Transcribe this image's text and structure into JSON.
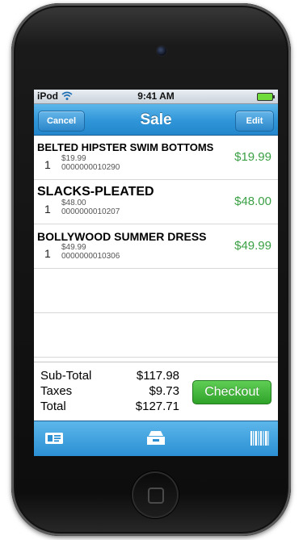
{
  "status": {
    "carrier": "iPod",
    "time": "9:41 AM"
  },
  "nav": {
    "title": "Sale",
    "cancel_label": "Cancel",
    "edit_label": "Edit"
  },
  "items": [
    {
      "name": "BELTED HIPSTER SWIM BOTTOMS",
      "qty": "1",
      "unit_price": "$19.99",
      "sku": "0000000010290",
      "price": "$19.99"
    },
    {
      "name": "SLACKS-PLEATED",
      "qty": "1",
      "unit_price": "$48.00",
      "sku": "0000000010207",
      "price": "$48.00"
    },
    {
      "name": "BOLLYWOOD SUMMER DRESS",
      "qty": "1",
      "unit_price": "$49.99",
      "sku": "0000000010306",
      "price": "$49.99"
    }
  ],
  "totals": {
    "subtotal_label": "Sub-Total",
    "subtotal_value": "$117.98",
    "taxes_label": "Taxes",
    "taxes_value": "$9.73",
    "total_label": "Total",
    "total_value": "$127.71",
    "checkout_label": "Checkout"
  },
  "tabs": [
    {
      "icon": "customer-card-icon"
    },
    {
      "icon": "register-tray-icon"
    },
    {
      "icon": "barcode-icon"
    }
  ],
  "colors": {
    "accent_blue": "#2f95d8",
    "price_green": "#3ba046",
    "checkout_green": "#3cb136"
  }
}
